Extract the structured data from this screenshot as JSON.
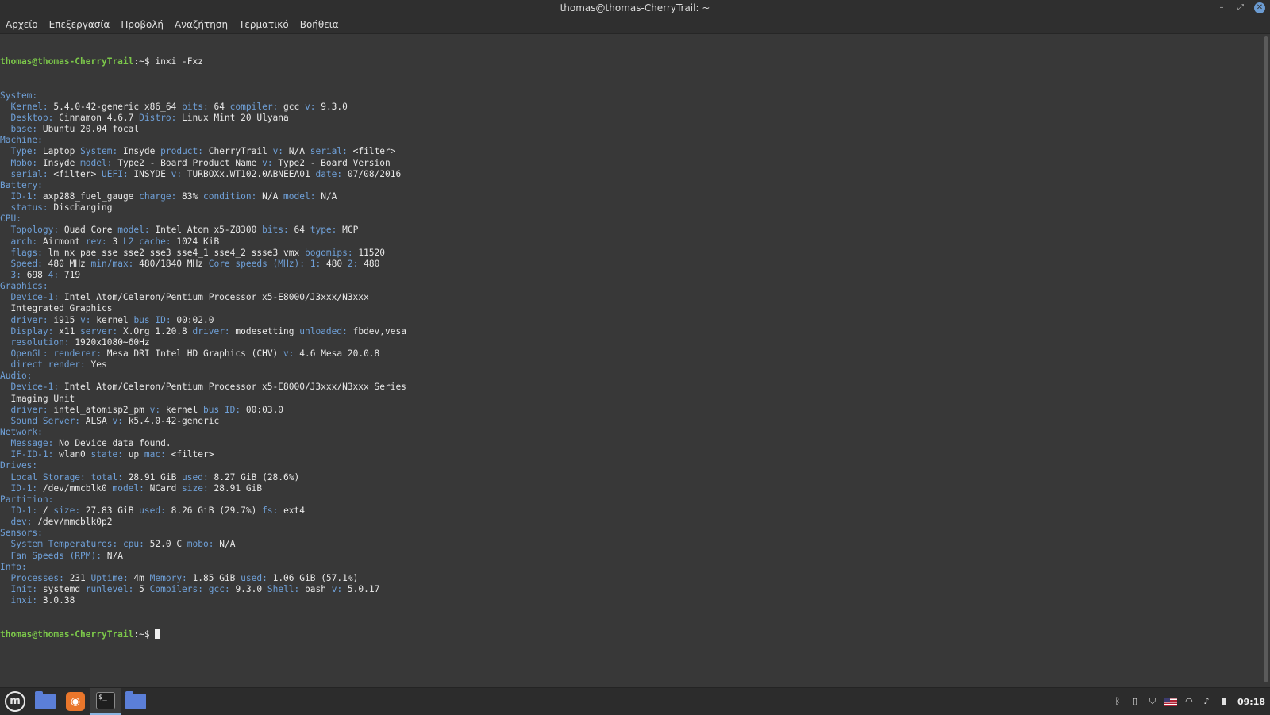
{
  "window": {
    "title": "thomas@thomas-CherryTrail: ~",
    "menu": [
      "Αρχείο",
      "Επεξεργασία",
      "Προβολή",
      "Αναζήτηση",
      "Τερματικό",
      "Βοήθεια"
    ]
  },
  "terminal": {
    "command_prompt": "thomas@thomas-CherryTrail",
    "command_suffix": ":~$ ",
    "command": "inxi -Fxz",
    "lines": [
      [
        [
          "k",
          "System:"
        ]
      ],
      [
        [
          "t",
          "  "
        ],
        [
          "k",
          "Kernel:"
        ],
        [
          "t",
          " 5.4.0-42-generic x86_64 "
        ],
        [
          "k",
          "bits:"
        ],
        [
          "t",
          " 64 "
        ],
        [
          "k",
          "compiler:"
        ],
        [
          "t",
          " gcc "
        ],
        [
          "k",
          "v:"
        ],
        [
          "t",
          " 9.3.0"
        ]
      ],
      [
        [
          "t",
          "  "
        ],
        [
          "k",
          "Desktop:"
        ],
        [
          "t",
          " Cinnamon 4.6.7 "
        ],
        [
          "k",
          "Distro:"
        ],
        [
          "t",
          " Linux Mint 20 Ulyana"
        ]
      ],
      [
        [
          "t",
          "  "
        ],
        [
          "k",
          "base:"
        ],
        [
          "t",
          " Ubuntu 20.04 focal"
        ]
      ],
      [
        [
          "k",
          "Machine:"
        ]
      ],
      [
        [
          "t",
          "  "
        ],
        [
          "k",
          "Type:"
        ],
        [
          "t",
          " Laptop "
        ],
        [
          "k",
          "System:"
        ],
        [
          "t",
          " Insyde "
        ],
        [
          "k",
          "product:"
        ],
        [
          "t",
          " CherryTrail "
        ],
        [
          "k",
          "v:"
        ],
        [
          "t",
          " N/A "
        ],
        [
          "k",
          "serial:"
        ],
        [
          "t",
          " <filter>"
        ]
      ],
      [
        [
          "t",
          "  "
        ],
        [
          "k",
          "Mobo:"
        ],
        [
          "t",
          " Insyde "
        ],
        [
          "k",
          "model:"
        ],
        [
          "t",
          " Type2 - Board Product Name "
        ],
        [
          "k",
          "v:"
        ],
        [
          "t",
          " Type2 - Board Version"
        ]
      ],
      [
        [
          "t",
          "  "
        ],
        [
          "k",
          "serial:"
        ],
        [
          "t",
          " <filter> "
        ],
        [
          "k",
          "UEFI:"
        ],
        [
          "t",
          " INSYDE "
        ],
        [
          "k",
          "v:"
        ],
        [
          "t",
          " TURBOXx.WT102.0ABNEEA01 "
        ],
        [
          "k",
          "date:"
        ],
        [
          "t",
          " 07/08/2016"
        ]
      ],
      [
        [
          "k",
          "Battery:"
        ]
      ],
      [
        [
          "t",
          "  "
        ],
        [
          "k",
          "ID-1:"
        ],
        [
          "t",
          " axp288_fuel_gauge "
        ],
        [
          "k",
          "charge:"
        ],
        [
          "t",
          " 83% "
        ],
        [
          "k",
          "condition:"
        ],
        [
          "t",
          " N/A "
        ],
        [
          "k",
          "model:"
        ],
        [
          "t",
          " N/A"
        ]
      ],
      [
        [
          "t",
          "  "
        ],
        [
          "k",
          "status:"
        ],
        [
          "t",
          " Discharging"
        ]
      ],
      [
        [
          "k",
          "CPU:"
        ]
      ],
      [
        [
          "t",
          "  "
        ],
        [
          "k",
          "Topology:"
        ],
        [
          "t",
          " Quad Core "
        ],
        [
          "k",
          "model:"
        ],
        [
          "t",
          " Intel Atom x5-Z8300 "
        ],
        [
          "k",
          "bits:"
        ],
        [
          "t",
          " 64 "
        ],
        [
          "k",
          "type:"
        ],
        [
          "t",
          " MCP"
        ]
      ],
      [
        [
          "t",
          "  "
        ],
        [
          "k",
          "arch:"
        ],
        [
          "t",
          " Airmont "
        ],
        [
          "k",
          "rev:"
        ],
        [
          "t",
          " 3 "
        ],
        [
          "k",
          "L2 cache:"
        ],
        [
          "t",
          " 1024 KiB"
        ]
      ],
      [
        [
          "t",
          "  "
        ],
        [
          "k",
          "flags:"
        ],
        [
          "t",
          " lm nx pae sse sse2 sse3 sse4_1 sse4_2 ssse3 vmx "
        ],
        [
          "k",
          "bogomips:"
        ],
        [
          "t",
          " 11520"
        ]
      ],
      [
        [
          "t",
          "  "
        ],
        [
          "k",
          "Speed:"
        ],
        [
          "t",
          " 480 MHz "
        ],
        [
          "k",
          "min/max:"
        ],
        [
          "t",
          " 480/1840 MHz "
        ],
        [
          "k",
          "Core speeds (MHz):"
        ],
        [
          "t",
          " "
        ],
        [
          "k",
          "1:"
        ],
        [
          "t",
          " 480 "
        ],
        [
          "k",
          "2:"
        ],
        [
          "t",
          " 480"
        ]
      ],
      [
        [
          "t",
          "  "
        ],
        [
          "k",
          "3:"
        ],
        [
          "t",
          " 698 "
        ],
        [
          "k",
          "4:"
        ],
        [
          "t",
          " 719"
        ]
      ],
      [
        [
          "k",
          "Graphics:"
        ]
      ],
      [
        [
          "t",
          "  "
        ],
        [
          "k",
          "Device-1:"
        ],
        [
          "t",
          " Intel Atom/Celeron/Pentium Processor x5-E8000/J3xxx/N3xxx"
        ]
      ],
      [
        [
          "t",
          "  Integrated Graphics"
        ]
      ],
      [
        [
          "t",
          "  "
        ],
        [
          "k",
          "driver:"
        ],
        [
          "t",
          " i915 "
        ],
        [
          "k",
          "v:"
        ],
        [
          "t",
          " kernel "
        ],
        [
          "k",
          "bus ID:"
        ],
        [
          "t",
          " 00:02.0"
        ]
      ],
      [
        [
          "t",
          "  "
        ],
        [
          "k",
          "Display:"
        ],
        [
          "t",
          " x11 "
        ],
        [
          "k",
          "server:"
        ],
        [
          "t",
          " X.Org 1.20.8 "
        ],
        [
          "k",
          "driver:"
        ],
        [
          "t",
          " modesetting "
        ],
        [
          "k",
          "unloaded:"
        ],
        [
          "t",
          " fbdev,vesa"
        ]
      ],
      [
        [
          "t",
          "  "
        ],
        [
          "k",
          "resolution:"
        ],
        [
          "t",
          " 1920x1080~60Hz"
        ]
      ],
      [
        [
          "t",
          "  "
        ],
        [
          "k",
          "OpenGL:"
        ],
        [
          "t",
          " "
        ],
        [
          "k",
          "renderer:"
        ],
        [
          "t",
          " Mesa DRI Intel HD Graphics (CHV) "
        ],
        [
          "k",
          "v:"
        ],
        [
          "t",
          " 4.6 Mesa 20.0.8"
        ]
      ],
      [
        [
          "t",
          "  "
        ],
        [
          "k",
          "direct render:"
        ],
        [
          "t",
          " Yes"
        ]
      ],
      [
        [
          "k",
          "Audio:"
        ]
      ],
      [
        [
          "t",
          "  "
        ],
        [
          "k",
          "Device-1:"
        ],
        [
          "t",
          " Intel Atom/Celeron/Pentium Processor x5-E8000/J3xxx/N3xxx Series"
        ]
      ],
      [
        [
          "t",
          "  Imaging Unit"
        ]
      ],
      [
        [
          "t",
          "  "
        ],
        [
          "k",
          "driver:"
        ],
        [
          "t",
          " intel_atomisp2_pm "
        ],
        [
          "k",
          "v:"
        ],
        [
          "t",
          " kernel "
        ],
        [
          "k",
          "bus ID:"
        ],
        [
          "t",
          " 00:03.0"
        ]
      ],
      [
        [
          "t",
          "  "
        ],
        [
          "k",
          "Sound Server:"
        ],
        [
          "t",
          " ALSA "
        ],
        [
          "k",
          "v:"
        ],
        [
          "t",
          " k5.4.0-42-generic"
        ]
      ],
      [
        [
          "k",
          "Network:"
        ]
      ],
      [
        [
          "t",
          "  "
        ],
        [
          "k",
          "Message:"
        ],
        [
          "t",
          " No Device data found."
        ]
      ],
      [
        [
          "t",
          "  "
        ],
        [
          "k",
          "IF-ID-1:"
        ],
        [
          "t",
          " wlan0 "
        ],
        [
          "k",
          "state:"
        ],
        [
          "t",
          " up "
        ],
        [
          "k",
          "mac:"
        ],
        [
          "t",
          " <filter>"
        ]
      ],
      [
        [
          "k",
          "Drives:"
        ]
      ],
      [
        [
          "t",
          "  "
        ],
        [
          "k",
          "Local Storage:"
        ],
        [
          "t",
          " "
        ],
        [
          "k",
          "total:"
        ],
        [
          "t",
          " 28.91 GiB "
        ],
        [
          "k",
          "used:"
        ],
        [
          "t",
          " 8.27 GiB (28.6%)"
        ]
      ],
      [
        [
          "t",
          "  "
        ],
        [
          "k",
          "ID-1:"
        ],
        [
          "t",
          " /dev/mmcblk0 "
        ],
        [
          "k",
          "model:"
        ],
        [
          "t",
          " NCard "
        ],
        [
          "k",
          "size:"
        ],
        [
          "t",
          " 28.91 GiB"
        ]
      ],
      [
        [
          "k",
          "Partition:"
        ]
      ],
      [
        [
          "t",
          "  "
        ],
        [
          "k",
          "ID-1:"
        ],
        [
          "t",
          " / "
        ],
        [
          "k",
          "size:"
        ],
        [
          "t",
          " 27.83 GiB "
        ],
        [
          "k",
          "used:"
        ],
        [
          "t",
          " 8.26 GiB (29.7%) "
        ],
        [
          "k",
          "fs:"
        ],
        [
          "t",
          " ext4"
        ]
      ],
      [
        [
          "t",
          "  "
        ],
        [
          "k",
          "dev:"
        ],
        [
          "t",
          " /dev/mmcblk0p2"
        ]
      ],
      [
        [
          "k",
          "Sensors:"
        ]
      ],
      [
        [
          "t",
          "  "
        ],
        [
          "k",
          "System Temperatures:"
        ],
        [
          "t",
          " "
        ],
        [
          "k",
          "cpu:"
        ],
        [
          "t",
          " 52.0 C "
        ],
        [
          "k",
          "mobo:"
        ],
        [
          "t",
          " N/A"
        ]
      ],
      [
        [
          "t",
          "  "
        ],
        [
          "k",
          "Fan Speeds (RPM):"
        ],
        [
          "t",
          " N/A"
        ]
      ],
      [
        [
          "k",
          "Info:"
        ]
      ],
      [
        [
          "t",
          "  "
        ],
        [
          "k",
          "Processes:"
        ],
        [
          "t",
          " 231 "
        ],
        [
          "k",
          "Uptime:"
        ],
        [
          "t",
          " 4m "
        ],
        [
          "k",
          "Memory:"
        ],
        [
          "t",
          " 1.85 GiB "
        ],
        [
          "k",
          "used:"
        ],
        [
          "t",
          " 1.06 GiB (57.1%)"
        ]
      ],
      [
        [
          "t",
          "  "
        ],
        [
          "k",
          "Init:"
        ],
        [
          "t",
          " systemd "
        ],
        [
          "k",
          "runlevel:"
        ],
        [
          "t",
          " 5 "
        ],
        [
          "k",
          "Compilers:"
        ],
        [
          "t",
          " "
        ],
        [
          "k",
          "gcc:"
        ],
        [
          "t",
          " 9.3.0 "
        ],
        [
          "k",
          "Shell:"
        ],
        [
          "t",
          " bash "
        ],
        [
          "k",
          "v:"
        ],
        [
          "t",
          " 5.0.17"
        ]
      ],
      [
        [
          "t",
          "  "
        ],
        [
          "k",
          "inxi:"
        ],
        [
          "t",
          " 3.0.38"
        ]
      ]
    ]
  },
  "taskbar": {
    "menu_logo": "m",
    "apps": [
      {
        "icon": "folder-icon"
      },
      {
        "icon": "firefox-icon"
      },
      {
        "icon": "terminal-icon",
        "glyph": "$_"
      },
      {
        "icon": "folder-icon"
      }
    ],
    "clock": "09:18",
    "tray_icons": [
      "bluetooth-icon",
      "clipboard-icon",
      "shield-icon",
      "keyboard-layout-flag-icon",
      "wifi-icon",
      "volume-icon",
      "battery-icon"
    ],
    "accent_color": "#8ab4e0"
  },
  "colors": {
    "terminal_bg": "#383838",
    "key_color": "#6fa0d8",
    "prompt_color": "#7cc84a"
  }
}
